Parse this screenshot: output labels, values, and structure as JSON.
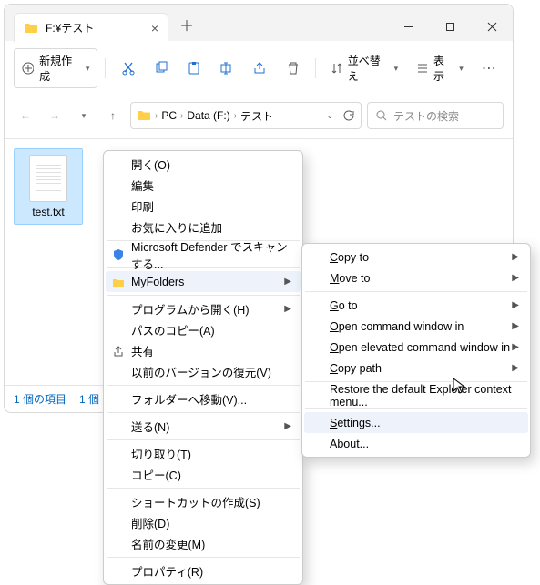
{
  "window": {
    "tab_title": "F:¥テスト"
  },
  "toolbar": {
    "new_label": "新規作成",
    "sort_label": "並べ替え",
    "view_label": "表示"
  },
  "breadcrumb": [
    "PC",
    "Data (F:)",
    "テスト"
  ],
  "search": {
    "placeholder": "テストの検索"
  },
  "file": {
    "name": "test.txt"
  },
  "status": {
    "items": "1 個の項目",
    "selection": "1 個"
  },
  "ctx": {
    "open": "開く(O)",
    "edit": "編集",
    "print": "印刷",
    "fav": "お気に入りに追加",
    "defender": "Microsoft Defender でスキャンする...",
    "myfolders": "MyFolders",
    "openwith": "プログラムから開く(H)",
    "copypath": "パスのコピー(A)",
    "share": "共有",
    "prev": "以前のバージョンの復元(V)",
    "movefolder": "フォルダーへ移動(V)...",
    "sendto": "送る(N)",
    "cut": "切り取り(T)",
    "copy": "コピー(C)",
    "shortcut": "ショートカットの作成(S)",
    "delete": "削除(D)",
    "rename": "名前の変更(M)",
    "prop": "プロパティ(R)"
  },
  "sub": {
    "copyto": "Copy to",
    "moveto": "Move to",
    "goto": "Go to",
    "opencmd": "Open command window in",
    "openelev": "Open elevated command window in",
    "copypath": "Copy path",
    "restore": "Restore the default Explorer context menu...",
    "settings": "Settings...",
    "about": "About..."
  }
}
